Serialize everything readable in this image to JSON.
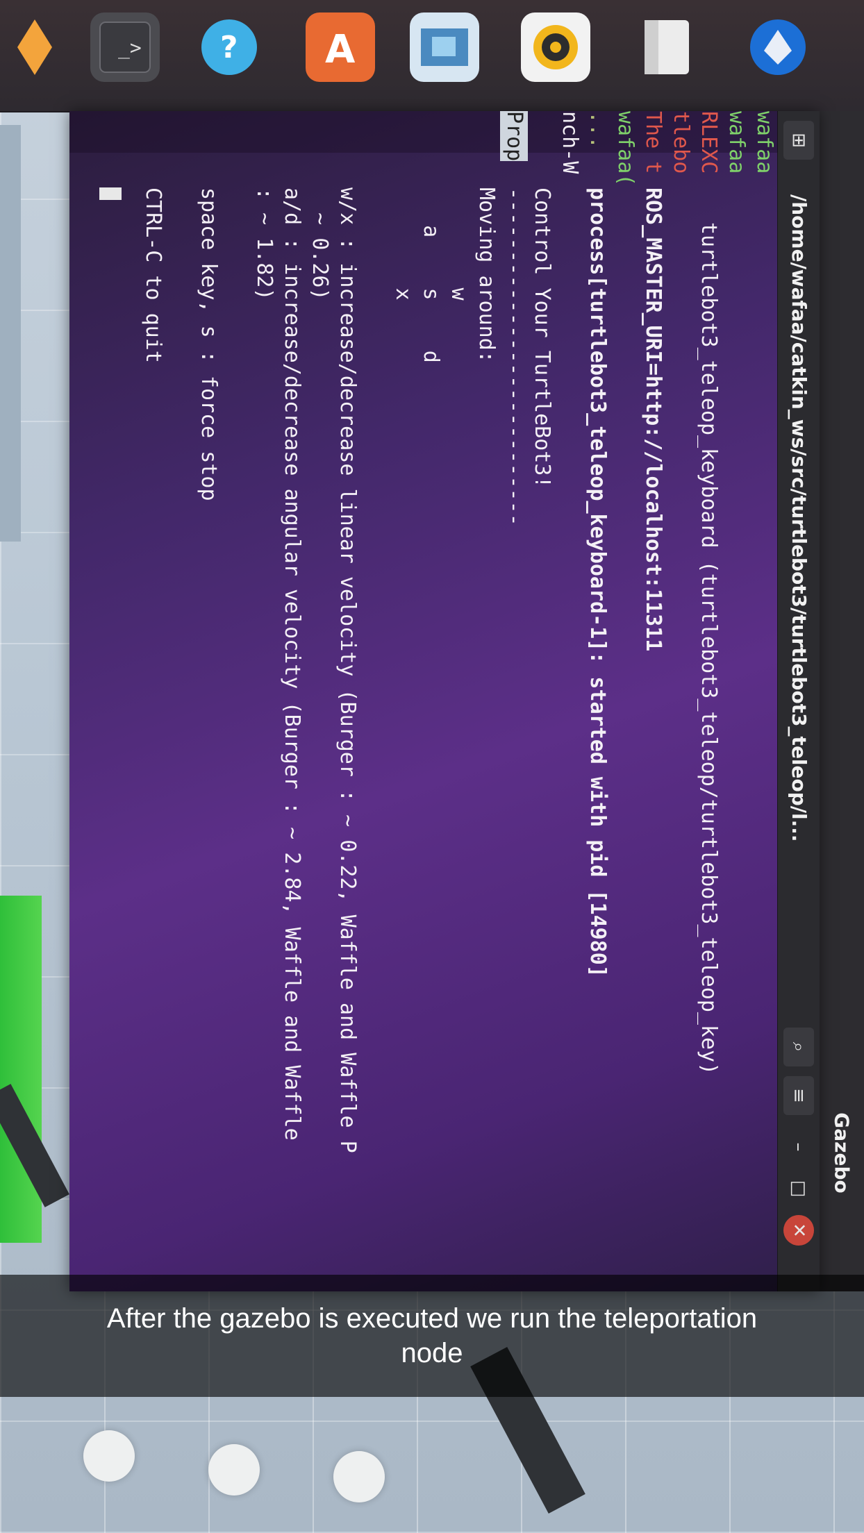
{
  "window": {
    "gazebo_title": "Gazebo",
    "terminal_title": "/home/wafaa/catkin_ws/src/turtlebot3/turtlebot3_teleop/l...",
    "new_tab_icon": "plus-icon",
    "search_icon": "search-icon",
    "menu_icon": "hamburger-icon",
    "minimize_label": "–",
    "maximize_label": "□",
    "close_label": "✕"
  },
  "dock": {
    "icons": [
      "diamond-icon",
      "terminal-icon",
      "help-icon",
      "software-store-icon",
      "image-viewer-icon",
      "music-player-icon",
      "files-icon",
      "thunderbird-icon"
    ]
  },
  "terminal": {
    "side_prefixes": [
      "wafaa",
      "wafaa",
      "RLEXC",
      "tlebo",
      "The t",
      "wafaa(",
      "...",
      "nch-W",
      "Prop"
    ],
    "lines": [
      "turtlebot3_teleop_keyboard (turtlebot3_teleop/turtlebot3_teleop_key)",
      "ROS_MASTER_URI=http://localhost:11311",
      "process[turtlebot3_teleop_keyboard-1]: started with pid [14980]",
      "Control Your TurtleBot3!",
      "---------------------------",
      "Moving around:",
      "        w",
      "   a    s    d",
      "        x",
      "w/x : increase/decrease linear velocity (Burger : ~ 0.22, Waffle and Waffle P",
      "  ~ 0.26)",
      "a/d : increase/decrease angular velocity (Burger : ~ 2.84, Waffle and Waffle",
      ": ~ 1.82)",
      "space key, s : force stop",
      "CTRL-C to quit"
    ]
  },
  "caption": {
    "text": "After the gazebo is executed we run the teleportation node"
  },
  "colors": {
    "terminal_bg": "#4a2a70",
    "prompt_green": "#7fd16a",
    "error_red": "#e0584c"
  }
}
